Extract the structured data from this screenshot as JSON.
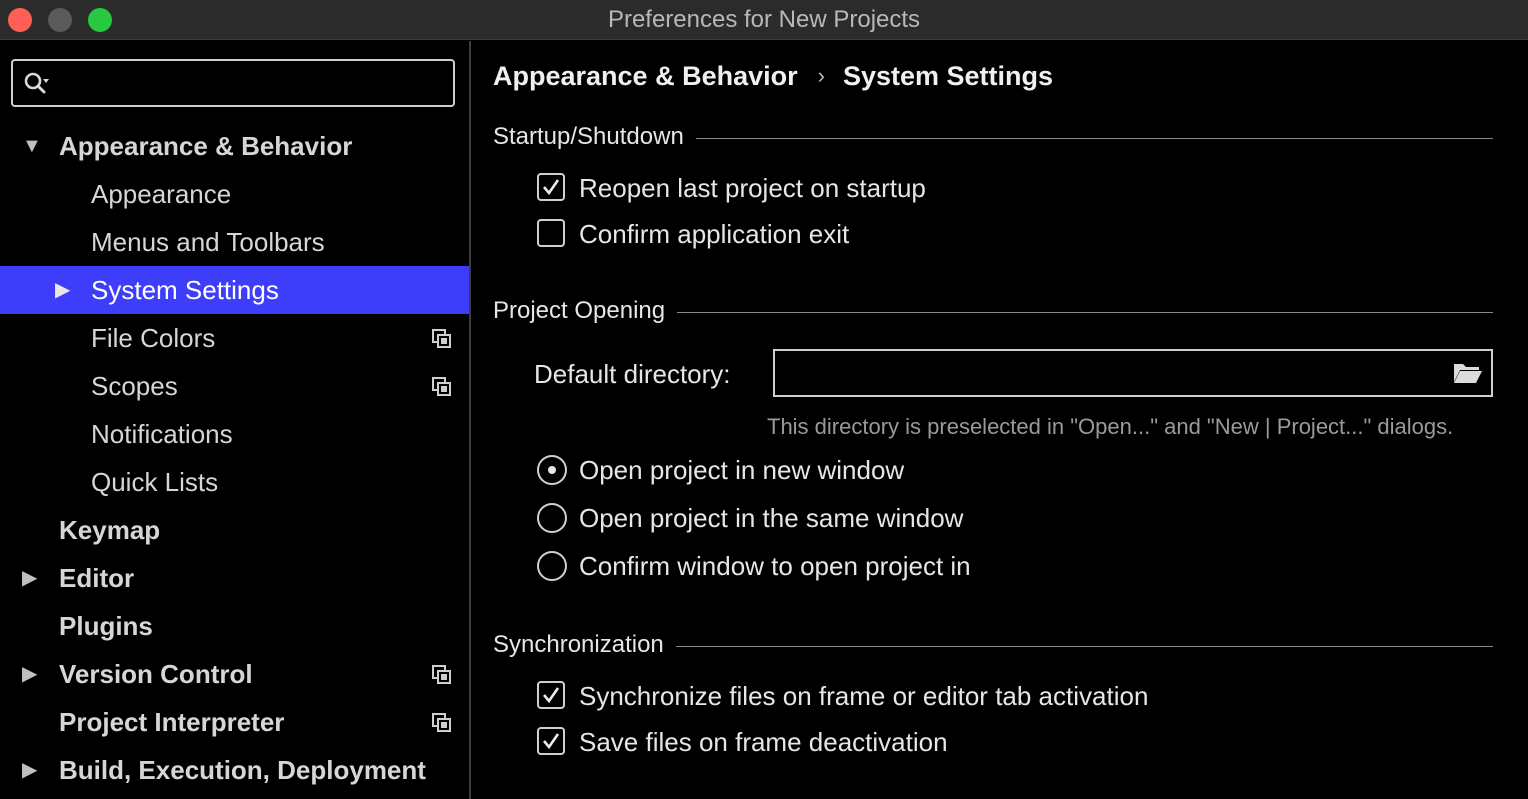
{
  "window": {
    "title": "Preferences for New Projects"
  },
  "search": {
    "placeholder": "",
    "value": ""
  },
  "sidebar": {
    "items": [
      {
        "label": "Appearance & Behavior",
        "level": 0,
        "expanded": true
      },
      {
        "label": "Appearance",
        "level": 1
      },
      {
        "label": "Menus and Toolbars",
        "level": 1
      },
      {
        "label": "System Settings",
        "level": 1,
        "selected": true
      },
      {
        "label": "File Colors",
        "level": 1,
        "project_icon": true
      },
      {
        "label": "Scopes",
        "level": 1,
        "project_icon": true
      },
      {
        "label": "Notifications",
        "level": 1
      },
      {
        "label": "Quick Lists",
        "level": 1
      },
      {
        "label": "Keymap",
        "level": 0
      },
      {
        "label": "Editor",
        "level": 0,
        "expandable": true
      },
      {
        "label": "Plugins",
        "level": 0
      },
      {
        "label": "Version Control",
        "level": 0,
        "expandable": true,
        "project_icon": true
      },
      {
        "label": "Project Interpreter",
        "level": 0,
        "project_icon": true
      },
      {
        "label": "Build, Execution, Deployment",
        "level": 0,
        "expandable": true
      }
    ]
  },
  "breadcrumb": {
    "parent": "Appearance & Behavior",
    "separator": "›",
    "current": "System Settings"
  },
  "startup": {
    "title": "Startup/Shutdown",
    "reopen": {
      "label": "Reopen last project on startup",
      "checked": true
    },
    "confirm_exit": {
      "label": "Confirm application exit",
      "checked": false
    }
  },
  "project_opening": {
    "title": "Project Opening",
    "default_dir_label": "Default directory:",
    "default_dir_value": "",
    "hint": "This directory is preselected in \"Open...\" and \"New | Project...\" dialogs.",
    "options": [
      {
        "label": "Open project in new window",
        "selected": true
      },
      {
        "label": "Open project in the same window",
        "selected": false
      },
      {
        "label": "Confirm window to open project in",
        "selected": false
      }
    ]
  },
  "sync": {
    "title": "Synchronization",
    "sync_files": {
      "label": "Synchronize files on frame or editor tab activation",
      "checked": true
    },
    "save_files": {
      "label": "Save files on frame deactivation",
      "checked": true
    }
  },
  "colors": {
    "selection": "#3d3dfa",
    "background": "#000000",
    "titlebar": "#2b2b2b"
  }
}
